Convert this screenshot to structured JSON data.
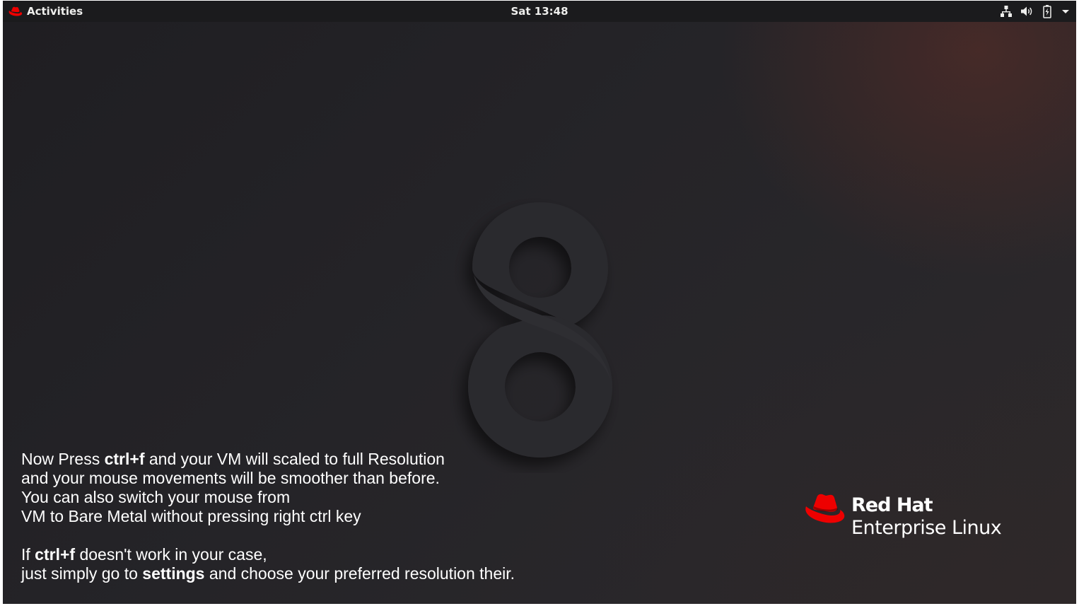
{
  "topbar": {
    "activities_label": "Activities",
    "clock": "Sat 13:48",
    "tray_icons": [
      "network-wired-icon",
      "volume-icon",
      "battery-charging-icon",
      "system-menu-chevron-icon"
    ]
  },
  "wallpaper": {
    "numeral": "8"
  },
  "instructions": {
    "p1_l1_a": "Now Press ",
    "p1_l1_b": "ctrl+f",
    "p1_l1_c": " and your VM will scaled to full Resolution",
    "p1_l2": "and your mouse movements will be smoother than before.",
    "p1_l3": "You can also switch your mouse from",
    "p1_l4": "VM to Bare Metal without pressing right ctrl key",
    "p2_l1_a": "If ",
    "p2_l1_b": "ctrl+f",
    "p2_l1_c": " doesn't work in your case,",
    "p2_l2_a": "just simply go to ",
    "p2_l2_b": "settings",
    "p2_l2_c": " and choose your preferred resolution their."
  },
  "brand": {
    "name": "Red Hat",
    "product": "Enterprise Linux",
    "logo_icon": "red-hat-fedora-icon",
    "accent_color": "#ee0000"
  },
  "colors": {
    "topbar_bg": "#1b1b1d",
    "desktop_bg": "#242327",
    "text": "#ffffff"
  }
}
